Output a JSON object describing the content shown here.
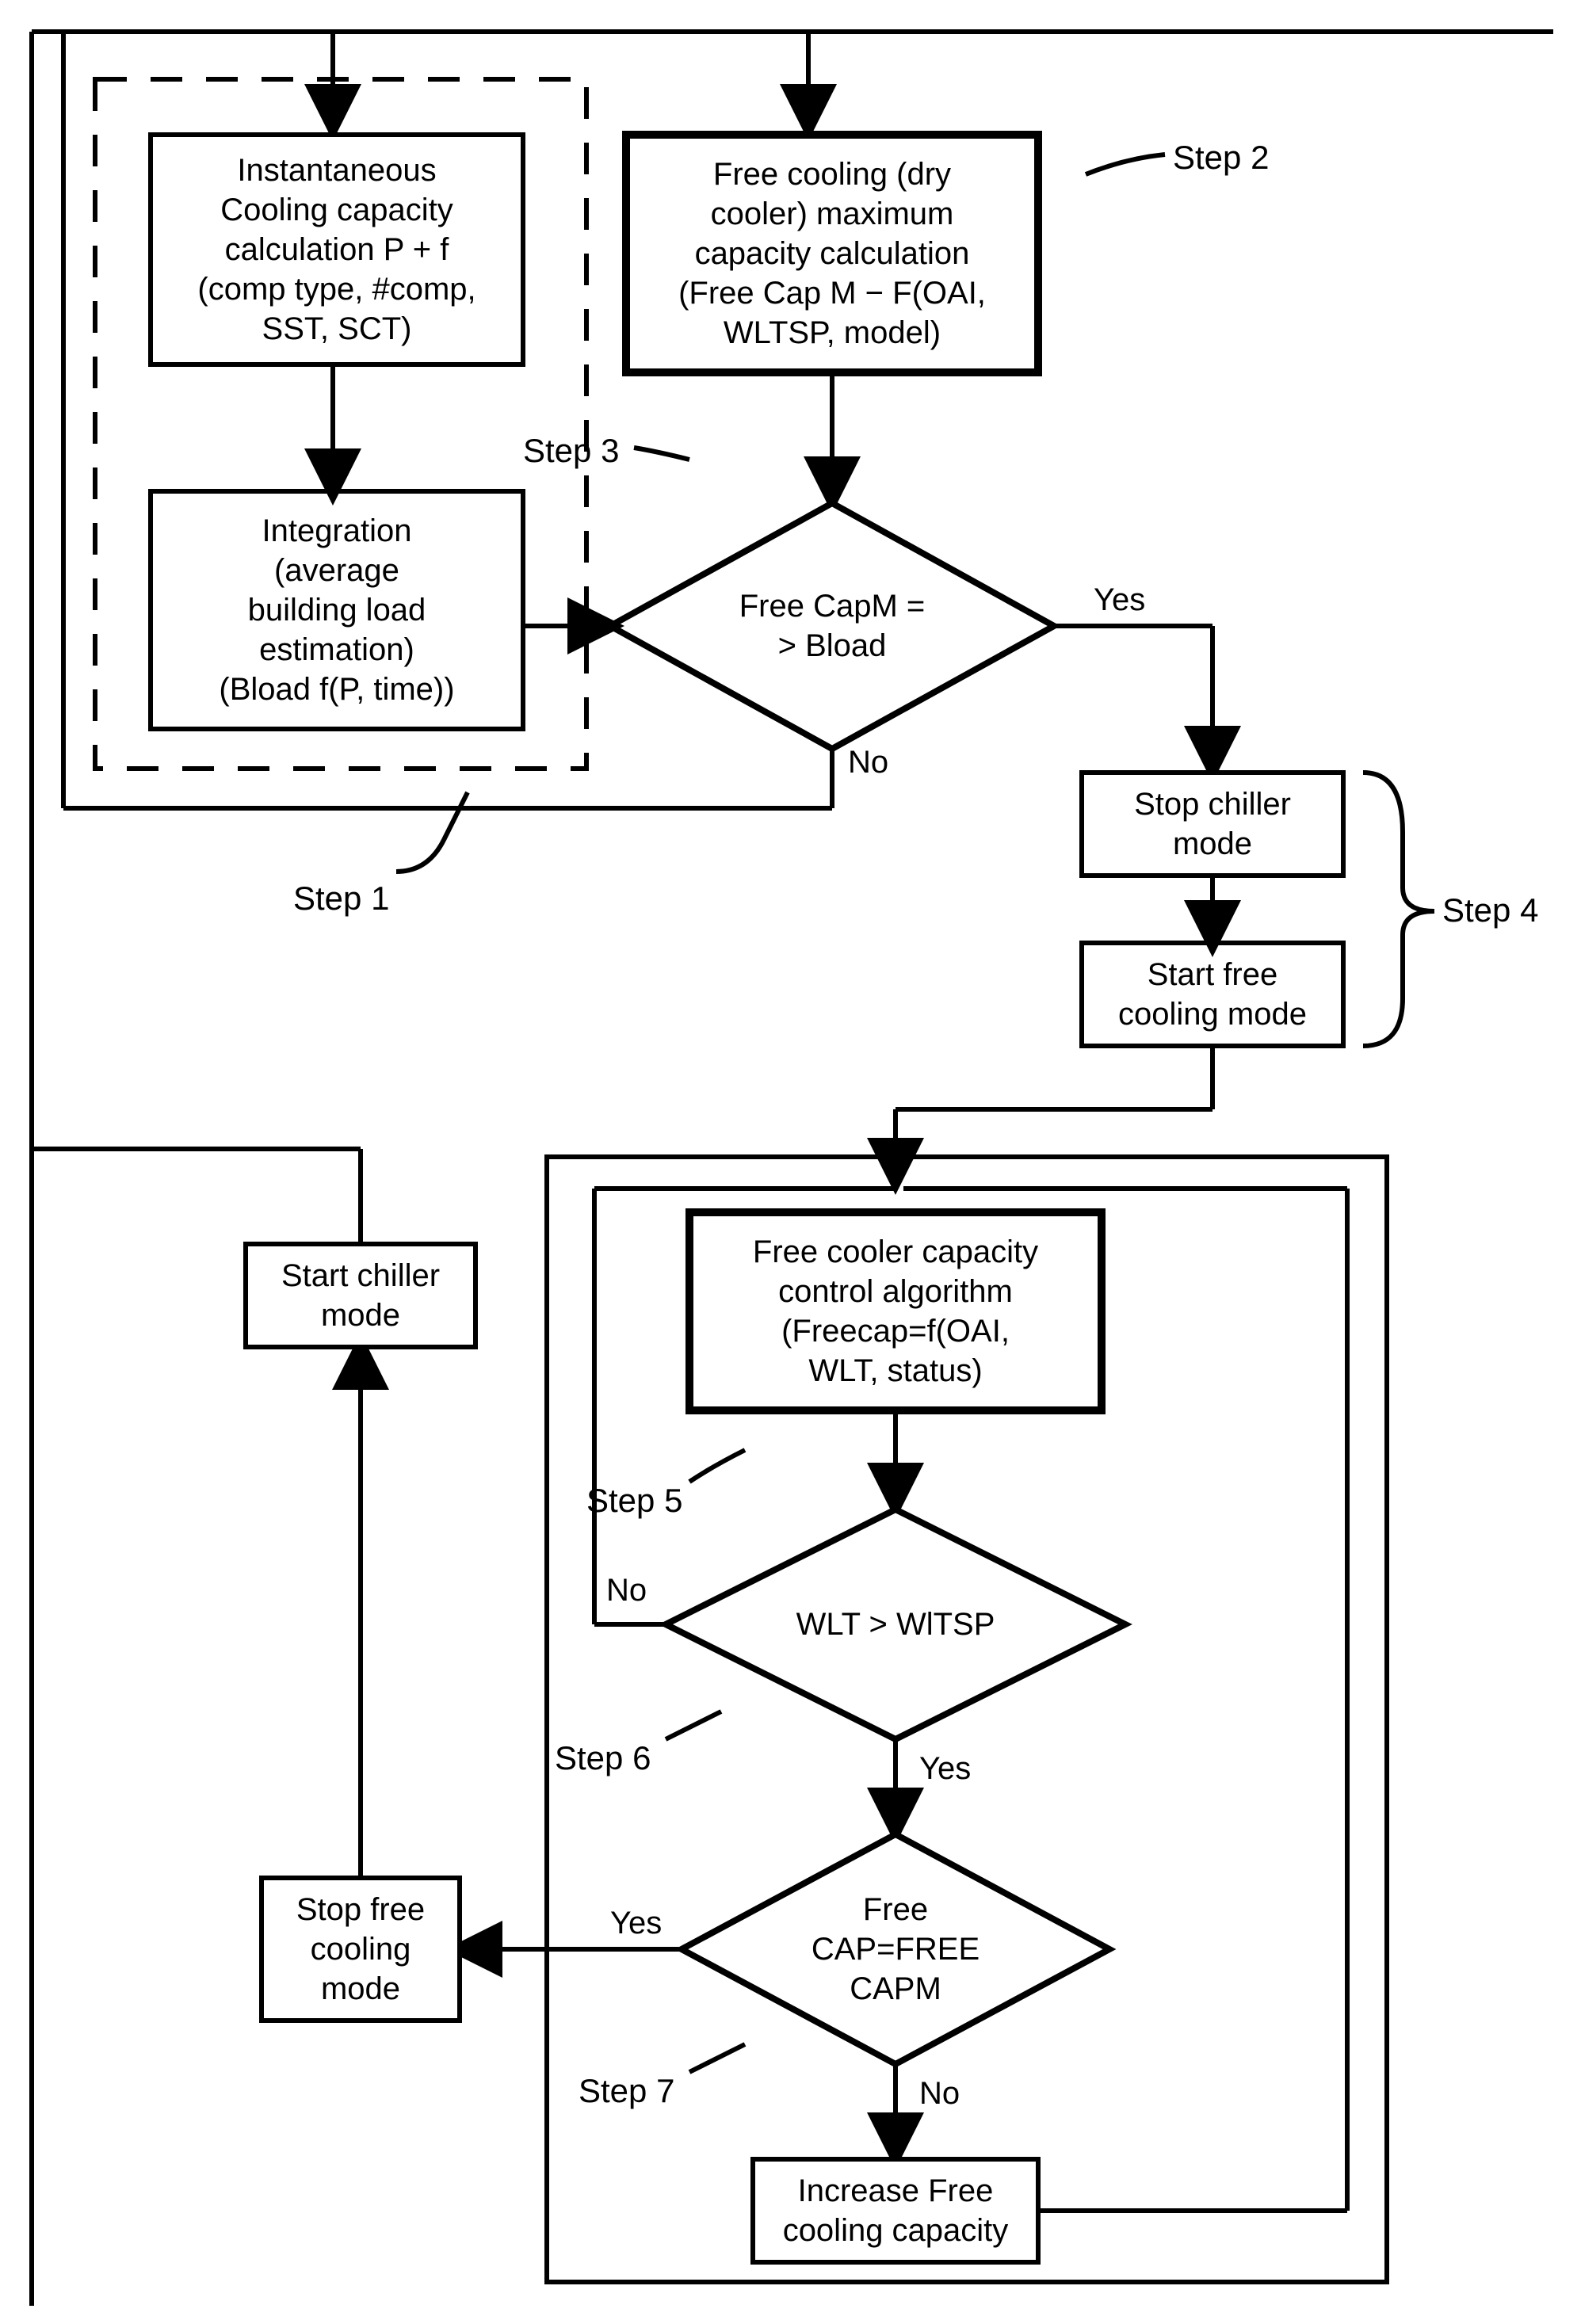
{
  "boxes": {
    "instCooling": "Instantaneous\nCooling capacity\ncalculation P + f\n(comp type, #comp,\nSST, SCT)",
    "integration": "Integration\n(average\nbuilding load\nestimation)\n(Bload f(P, time))",
    "freeCoolingMax": "Free cooling (dry\ncooler) maximum\ncapacity calculation\n(Free Cap M − F(OAI,\nWLTSP, model)",
    "stopChiller": "Stop chiller\nmode",
    "startFree": "Start free\ncooling mode",
    "startChiller": "Start chiller\nmode",
    "freeCapControl": "Free cooler capacity\ncontrol algorithm\n(Freecap=f(OAI,\nWLT, status)",
    "stopFree": "Stop free\ncooling\nmode",
    "increaseFree": "Increase Free\ncooling capacity"
  },
  "diamonds": {
    "d3": "Free CapM =\n> Bload",
    "d6": "WLT > WlTSP",
    "d7": "Free\nCAP=FREE\nCAPM"
  },
  "steps": {
    "s1": "Step 1",
    "s2": "Step 2",
    "s3": "Step 3",
    "s4": "Step 4",
    "s5": "Step 5",
    "s6": "Step 6",
    "s7": "Step 7"
  },
  "yn": {
    "yes": "Yes",
    "no": "No"
  }
}
